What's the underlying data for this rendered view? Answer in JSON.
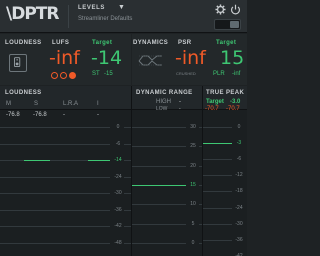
{
  "header": {
    "logo_mark": "\\DPTR",
    "logo_sub": "",
    "mode_label": "LEVELS",
    "preset_name": "Streamliner Defaults"
  },
  "loudness_top": {
    "section_label": "LOUDNESS",
    "lufs_label": "LUFS",
    "lufs_value": "-inf",
    "target_label": "Target",
    "target_value": "-14",
    "st_label": "ST",
    "st_value": "-15"
  },
  "dynamics_top": {
    "section_label": "DYNAMICS",
    "psr_label": "PSR",
    "psr_value": "-inf",
    "crushed_label": "CRUSHED",
    "target_label": "Target",
    "target_value": "15",
    "plr_label": "PLR",
    "plr_value": "-inf"
  },
  "loudness_meter": {
    "title": "LOUDNESS",
    "columns": [
      {
        "label": "M",
        "value": "-76.8"
      },
      {
        "label": "S",
        "value": "-76.8"
      },
      {
        "label": "L.R.A",
        "value": "-"
      },
      {
        "label": "I",
        "value": "-"
      }
    ],
    "scale": [
      "0",
      "-6",
      "-14",
      "-24",
      "-30",
      "-36",
      "-42",
      "-48"
    ],
    "highlight": "-14"
  },
  "dynamic_range": {
    "title": "DYNAMIC RANGE",
    "high_label": "HIGH",
    "high_value": "-",
    "low_label": "LOW",
    "low_value": "-",
    "scale": [
      "30",
      "25",
      "20",
      "15",
      "10",
      "5",
      "0"
    ],
    "highlight": "15"
  },
  "true_peak": {
    "title": "TRUE PEAK",
    "target_label": "Target",
    "target_value": "-3.0",
    "left_value": "-70.7",
    "right_value": "-70.7",
    "scale": [
      "0",
      "-3",
      "-6",
      "-12",
      "-18",
      "-24",
      "-30",
      "-36",
      "-42"
    ],
    "highlight": "-3"
  },
  "colors": {
    "accent_green": "#3ec773",
    "accent_orange": "#f05a28",
    "background": "#1e2224"
  }
}
